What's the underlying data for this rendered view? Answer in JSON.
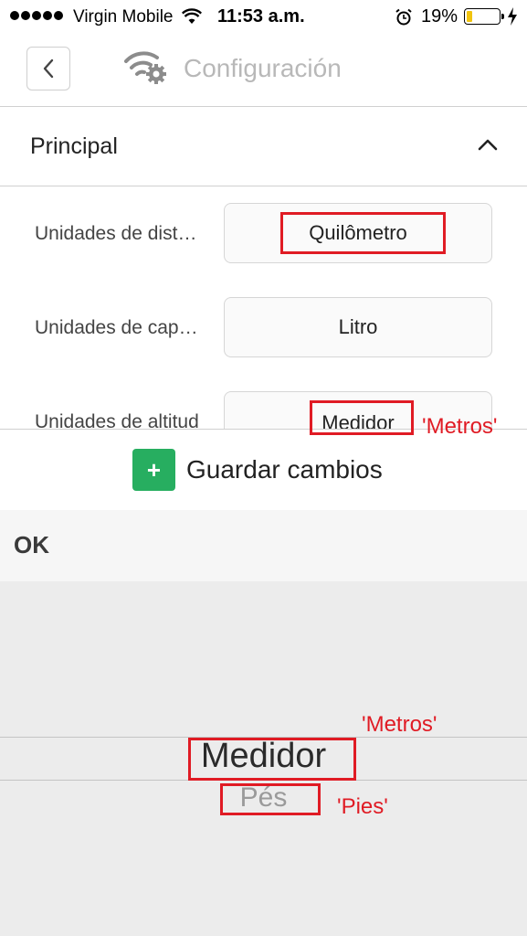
{
  "status_bar": {
    "carrier": "Virgin Mobile",
    "time": "11:53 a.m.",
    "battery_percent": "19%",
    "battery_level": 0.19
  },
  "header": {
    "back_icon": "chevron-left-icon",
    "settings_icon": "wifi-gear-icon",
    "title": "Configuración"
  },
  "section": {
    "title": "Principal",
    "toggle_icon": "chevron-up-icon"
  },
  "settings": [
    {
      "label": "Unidades de distancia",
      "value": "Quilômetro"
    },
    {
      "label": "Unidades de capacidad",
      "value": "Litro"
    },
    {
      "label": "Unidades de altitud",
      "value": "Medidor"
    }
  ],
  "save_button": {
    "icon": "plus-icon",
    "icon_glyph": "+",
    "label": "Guardar cambios"
  },
  "picker": {
    "ok_label": "OK",
    "options": [
      "Medidor",
      "Pés"
    ],
    "selected": "Medidor"
  },
  "annotations": {
    "altitude_note": "'Metros'",
    "picker_selected_note": "'Metros'",
    "picker_next_note": "'Pies'",
    "color": "#e01b24"
  }
}
